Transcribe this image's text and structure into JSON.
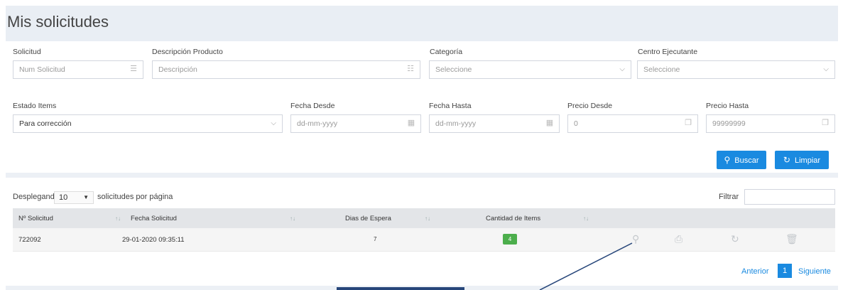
{
  "page": {
    "title": "Mis solicitudes"
  },
  "filters": {
    "solicitud": {
      "label": "Solicitud",
      "placeholder": "Num Solicitud"
    },
    "descripcion": {
      "label": "Descripción Producto",
      "placeholder": "Descripción"
    },
    "categoria": {
      "label": "Categoría",
      "value": "Seleccione"
    },
    "centro": {
      "label": "Centro Ejecutante",
      "value": "Seleccione"
    },
    "estado": {
      "label": "Estado Items",
      "value": "Para corrección"
    },
    "fecha_desde": {
      "label": "Fecha Desde",
      "placeholder": "dd-mm-yyyy"
    },
    "fecha_hasta": {
      "label": "Fecha Hasta",
      "placeholder": "dd-mm-yyyy"
    },
    "precio_desde": {
      "label": "Precio Desde",
      "placeholder": "0"
    },
    "precio_hasta": {
      "label": "Precio Hasta",
      "placeholder": "99999999"
    },
    "buscar_label": "Buscar",
    "limpiar_label": "Limpiar"
  },
  "table_controls": {
    "length_prefix": "Desplegando",
    "length_value": "10",
    "length_suffix": "solicitudes por página",
    "filter_label": "Filtrar"
  },
  "table": {
    "headers": [
      "Nº Solicitud",
      "Fecha Solicitud",
      "Dias de Espera",
      "Cantidad de Items"
    ],
    "rows": [
      {
        "num": "722092",
        "fecha": "29-01-2020 09:35:11",
        "dias": "7",
        "items": "4"
      }
    ]
  },
  "pager": {
    "prev": "Anterior",
    "current": "1",
    "next": "Siguiente"
  },
  "colors": {
    "accent": "#1a8ae0",
    "badge": "#4cae4c",
    "annotation": "#27467a"
  },
  "icons": [
    "list-number-icon",
    "list-icon",
    "chevron-down-icon",
    "calendar-icon",
    "copy-icon",
    "search-icon",
    "refresh-icon",
    "print-icon",
    "trash-icon"
  ]
}
